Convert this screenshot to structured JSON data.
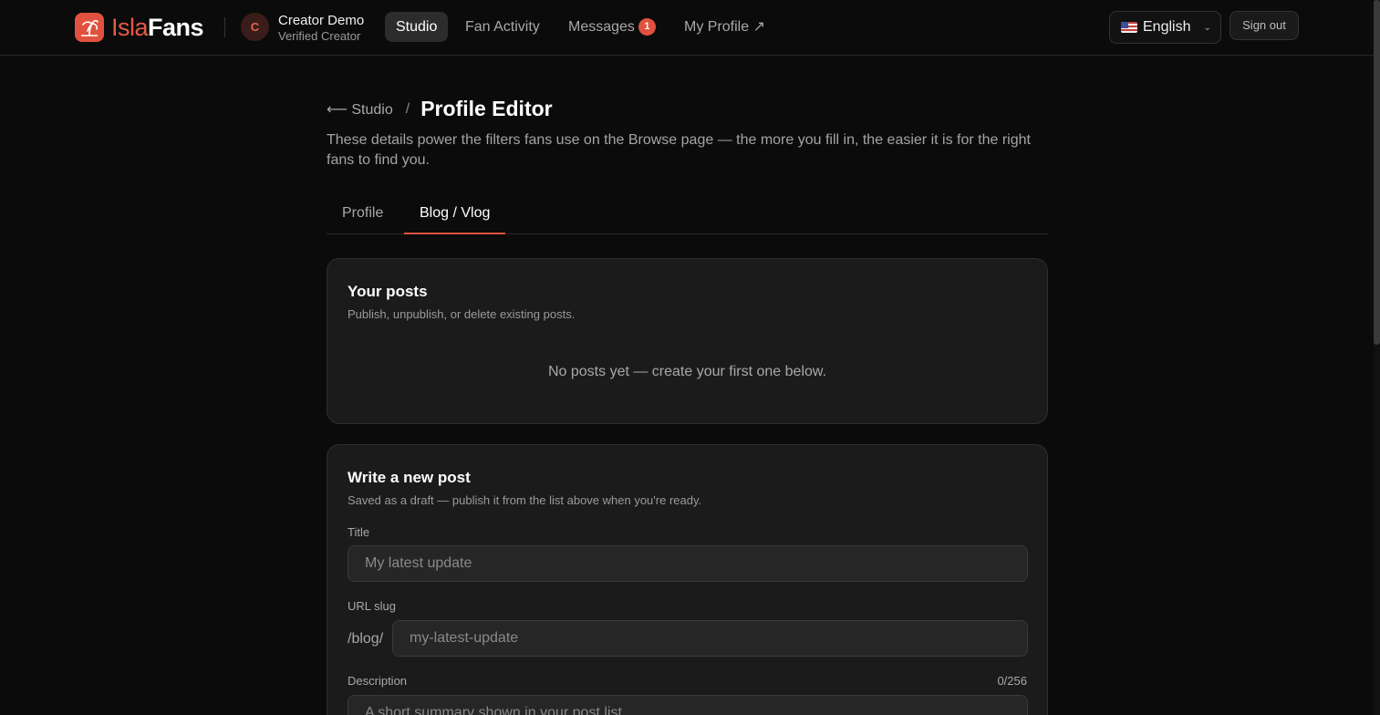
{
  "brand": {
    "part1": "Isla",
    "part2": "Fans",
    "accent": "#e0523f"
  },
  "user": {
    "initial": "C",
    "name": "Creator Demo",
    "role": "Verified Creator"
  },
  "nav": {
    "studio": "Studio",
    "fan_activity": "Fan Activity",
    "messages": "Messages",
    "messages_count": "1",
    "my_profile": "My Profile ↗"
  },
  "language": {
    "selected": "English"
  },
  "signout_label": "Sign out",
  "breadcrumb": {
    "back": "⟵ Studio",
    "separator": "/",
    "title": "Profile Editor"
  },
  "intro": "These details power the filters fans use on the Browse page — the more you fill in, the easier it is for the right fans to find you.",
  "tabs": [
    {
      "label": "Profile",
      "active": false
    },
    {
      "label": "Blog / Vlog",
      "active": true
    }
  ],
  "posts_card": {
    "title": "Your posts",
    "subtitle": "Publish, unpublish, or delete existing posts.",
    "empty": "No posts yet — create your first one below."
  },
  "new_post": {
    "title": "Write a new post",
    "subtitle": "Saved as a draft — publish it from the list above when you're ready.",
    "title_label": "Title",
    "title_placeholder": "My latest update",
    "slug_label": "URL slug",
    "slug_prefix": "/blog/",
    "slug_placeholder": "my-latest-update",
    "description_label": "Description",
    "description_counter": "0/256",
    "description_placeholder": "A short summary shown in your post list"
  }
}
